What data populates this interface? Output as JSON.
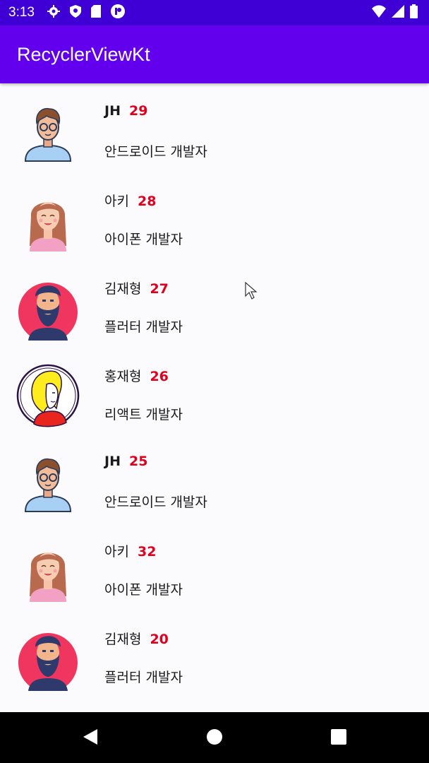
{
  "status_bar": {
    "time": "3:13",
    "left_icons": [
      "gear-icon",
      "shield-icon",
      "sd-card-icon",
      "app-notification-icon"
    ],
    "right_icons": [
      "wifi-icon",
      "signal-icon",
      "battery-icon"
    ]
  },
  "app_bar": {
    "title": "RecyclerViewKt"
  },
  "colors": {
    "status_bar": "#3f00d6",
    "app_bar": "#6200ee",
    "age": "#e0001e",
    "background": "#fbfbfd",
    "nav_bar": "#000000"
  },
  "items": [
    {
      "name": "JH",
      "age": "29",
      "job": "안드로이드 개발자",
      "avatar": "man-glasses-avatar"
    },
    {
      "name": "아키",
      "age": "28",
      "job": "아이폰 개발자",
      "avatar": "woman-long-hair-avatar"
    },
    {
      "name": "김재형",
      "age": "27",
      "job": "플러터 개발자",
      "avatar": "bearded-man-avatar"
    },
    {
      "name": "홍재형",
      "age": "26",
      "job": "리액트 개발자",
      "avatar": "blonde-woman-avatar"
    },
    {
      "name": "JH",
      "age": "25",
      "job": "안드로이드 개발자",
      "avatar": "man-glasses-avatar"
    },
    {
      "name": "아키",
      "age": "32",
      "job": "아이폰 개발자",
      "avatar": "woman-long-hair-avatar"
    },
    {
      "name": "김재형",
      "age": "20",
      "job": "플러터 개발자",
      "avatar": "bearded-man-avatar"
    }
  ],
  "nav_bar": {
    "buttons": [
      "back-icon",
      "home-icon",
      "recents-icon"
    ]
  }
}
